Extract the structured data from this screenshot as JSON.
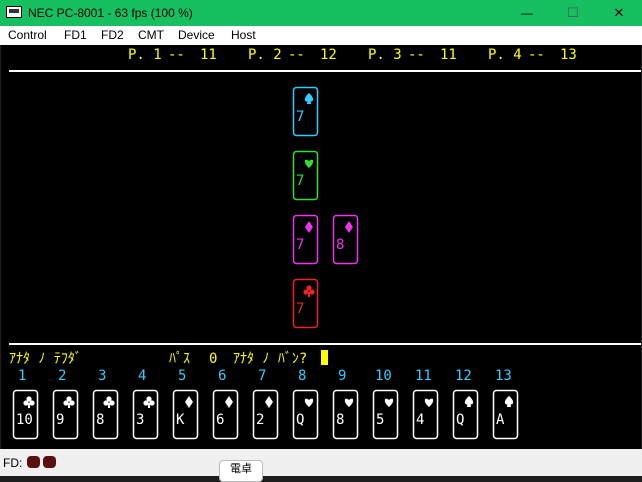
{
  "window": {
    "title": "NEC PC-8001 - 63 fps (100 %)",
    "minimize_glyph": "—",
    "maximize_glyph": "☐",
    "close_glyph": "✕"
  },
  "menu": [
    "Control",
    "FD1",
    "FD2",
    "CMT",
    "Device",
    "Host"
  ],
  "scores": [
    {
      "label": "P. 1",
      "sep": "--",
      "value": "11"
    },
    {
      "label": "P. 2",
      "sep": "--",
      "value": "12"
    },
    {
      "label": "P. 3",
      "sep": "--",
      "value": "11"
    },
    {
      "label": "P. 4",
      "sep": "--",
      "value": "13"
    }
  ],
  "table_cards": [
    {
      "rank": "7",
      "suit": "spade",
      "color": "#33ccff"
    },
    {
      "rank": "7",
      "suit": "heart",
      "color": "#33dd33"
    },
    {
      "rank": "7",
      "suit": "diamond",
      "color": "#ee33ee"
    },
    {
      "rank": "8",
      "suit": "diamond",
      "color": "#ee33ee"
    },
    {
      "rank": "7",
      "suit": "club",
      "color": "#ee2222"
    }
  ],
  "message": {
    "player_hand": "ｱﾅﾀ ﾉ ﾃﾌﾀﾞ",
    "pass_label": "ﾊﾟｽ",
    "pass_count": "0",
    "turn_prompt": "ｱﾅﾀ ﾉ ﾊﾞﾝ?"
  },
  "hand": [
    {
      "index": "1",
      "rank": "10",
      "suit": "club"
    },
    {
      "index": "2",
      "rank": "9",
      "suit": "club"
    },
    {
      "index": "3",
      "rank": "8",
      "suit": "club"
    },
    {
      "index": "4",
      "rank": "3",
      "suit": "club"
    },
    {
      "index": "5",
      "rank": "K",
      "suit": "diamond"
    },
    {
      "index": "6",
      "rank": "6",
      "suit": "diamond"
    },
    {
      "index": "7",
      "rank": "2",
      "suit": "diamond"
    },
    {
      "index": "8",
      "rank": "Q",
      "suit": "heart"
    },
    {
      "index": "9",
      "rank": "8",
      "suit": "heart"
    },
    {
      "index": "10",
      "rank": "5",
      "suit": "heart"
    },
    {
      "index": "11",
      "rank": "4",
      "suit": "heart"
    },
    {
      "index": "12",
      "rank": "Q",
      "suit": "spade"
    },
    {
      "index": "13",
      "rank": "A",
      "suit": "spade"
    }
  ],
  "colors": {
    "score_text": "#ffff00",
    "message_text": "#ffff00",
    "index_text": "#33ccff",
    "hand_card": "#ffffff",
    "cursor": "#ffff00",
    "divider": "#ffffff"
  },
  "status": {
    "fd_label": "FD:",
    "tooltip": "電卓"
  }
}
